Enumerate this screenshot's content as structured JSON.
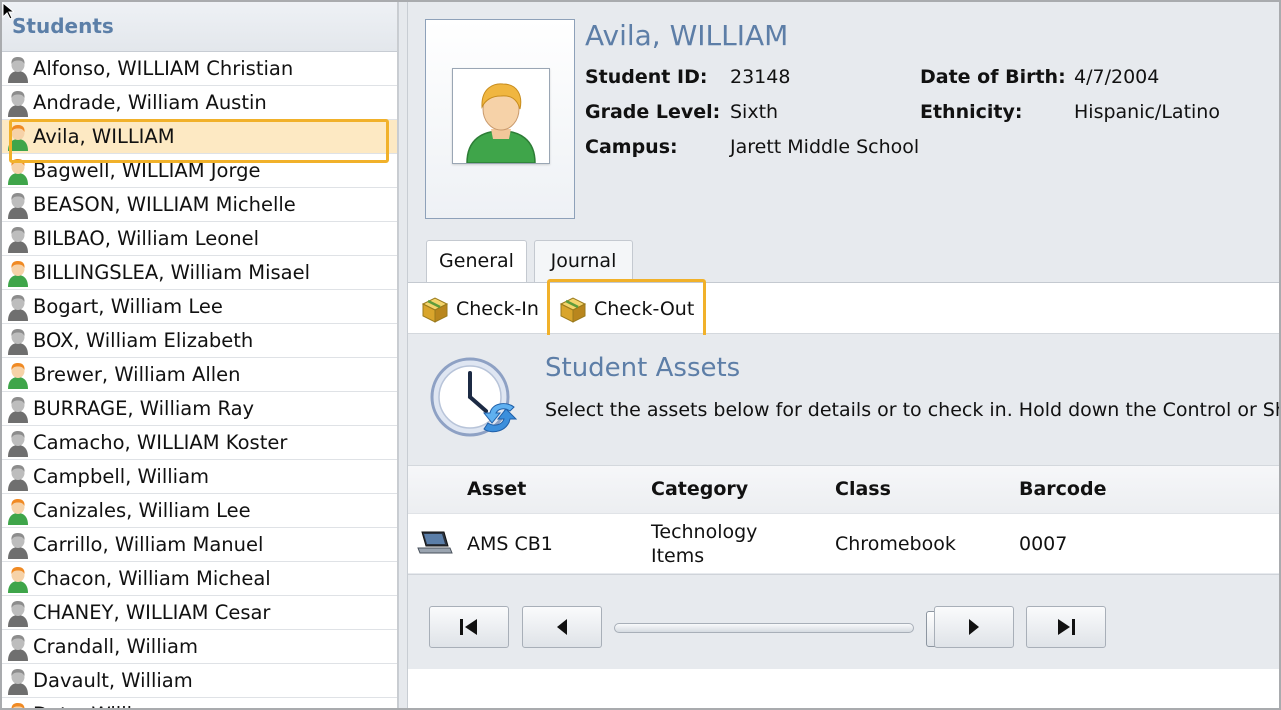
{
  "sidebar": {
    "title": "Students",
    "students": [
      {
        "name": "Alfonso, WILLIAM Christian",
        "icon": "gray"
      },
      {
        "name": "Andrade, William Austin",
        "icon": "gray"
      },
      {
        "name": "Avila, WILLIAM",
        "icon": "orange",
        "selected": true
      },
      {
        "name": "Bagwell, WILLIAM Jorge",
        "icon": "orange"
      },
      {
        "name": "BEASON, WILLIAM Michelle",
        "icon": "gray"
      },
      {
        "name": "BILBAO, William Leonel",
        "icon": "gray"
      },
      {
        "name": "BILLINGSLEA, William Misael",
        "icon": "orange"
      },
      {
        "name": "Bogart, William Lee",
        "icon": "gray"
      },
      {
        "name": "BOX, William Elizabeth",
        "icon": "gray"
      },
      {
        "name": "Brewer, William Allen",
        "icon": "orange"
      },
      {
        "name": "BURRAGE, William Ray",
        "icon": "gray"
      },
      {
        "name": "Camacho, WILLIAM Koster",
        "icon": "gray"
      },
      {
        "name": "Campbell, William",
        "icon": "gray"
      },
      {
        "name": "Canizales, William Lee",
        "icon": "orange"
      },
      {
        "name": "Carrillo, William Manuel",
        "icon": "gray"
      },
      {
        "name": "Chacon, William Micheal",
        "icon": "orange"
      },
      {
        "name": "CHANEY, WILLIAM Cesar",
        "icon": "gray"
      },
      {
        "name": "Crandall, William",
        "icon": "gray"
      },
      {
        "name": "Davault, William",
        "icon": "gray"
      },
      {
        "name": "Doty, William",
        "icon": "orange"
      }
    ]
  },
  "student": {
    "name": "Avila, WILLIAM",
    "labels": {
      "student_id": "Student ID:",
      "grade_level": "Grade Level:",
      "campus": "Campus:",
      "dob": "Date of Birth:",
      "ethnicity": "Ethnicity:"
    },
    "student_id": "23148",
    "grade_level": "Sixth",
    "campus": "Jarett Middle School",
    "dob": "4/7/2004",
    "ethnicity": "Hispanic/Latino"
  },
  "tabs": [
    {
      "label": "General",
      "active": true
    },
    {
      "label": "Journal",
      "active": false
    }
  ],
  "toolbar": {
    "checkin_label": "Check-In",
    "checkout_label": "Check-Out"
  },
  "assets": {
    "title": "Student Assets",
    "description": "Select the assets below for details or to check in. Hold down the Control or Sh",
    "columns": [
      "Asset",
      "Category",
      "Class",
      "Barcode"
    ],
    "rows": [
      {
        "asset": "AMS CB1",
        "category_line1": "Technology",
        "category_line2": "Items",
        "class": "Chromebook",
        "barcode": "0007"
      }
    ]
  },
  "colors": {
    "accent_blue": "#5d7ea7",
    "highlight_orange": "#f1b12a",
    "selected_row": "#fde9c3"
  }
}
